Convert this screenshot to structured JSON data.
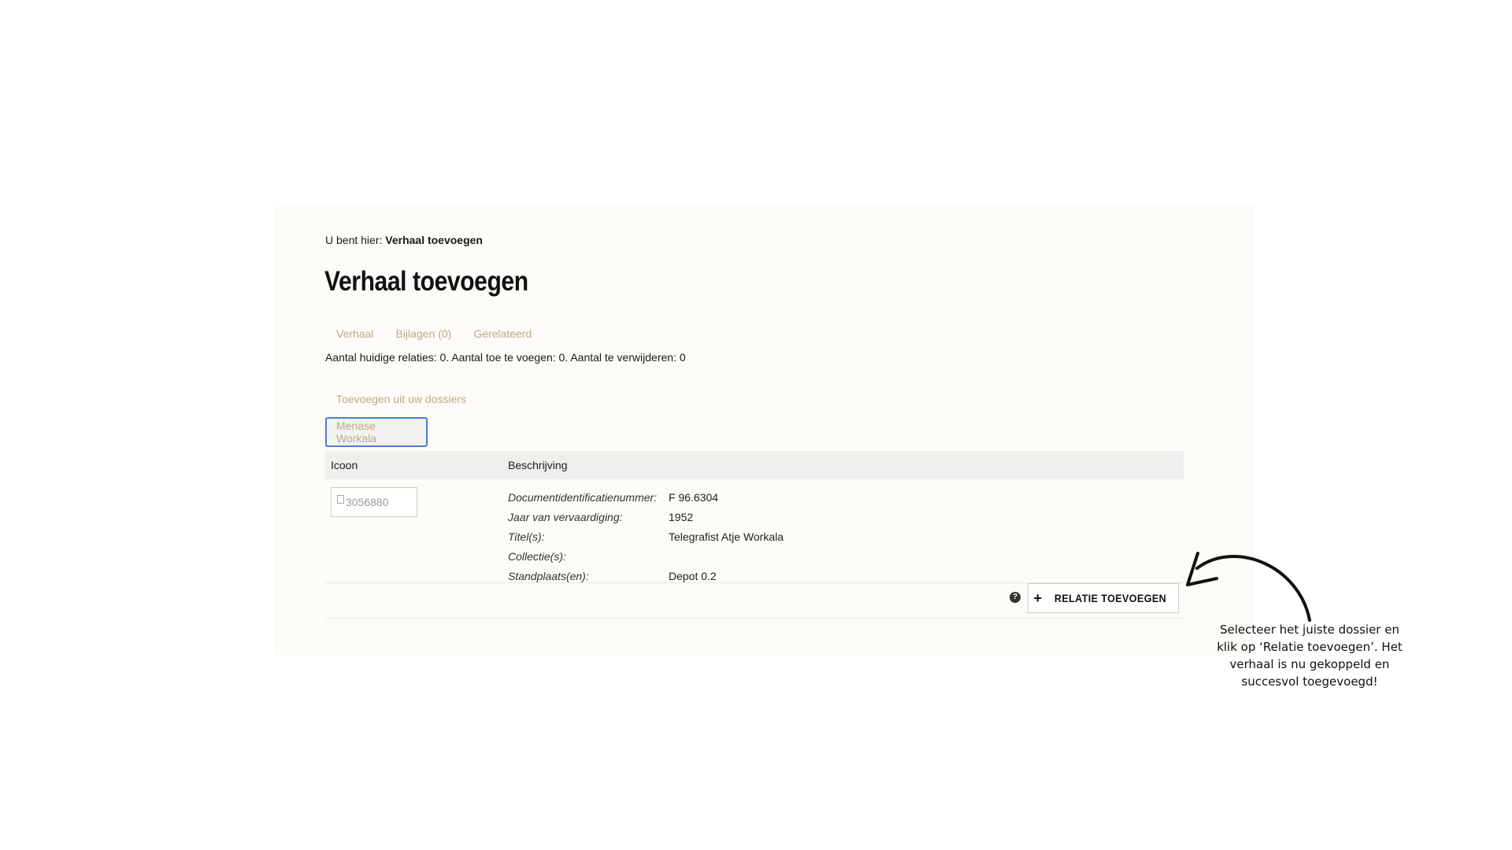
{
  "breadcrumb": {
    "prefix": "U bent hier:",
    "current": "Verhaal toevoegen"
  },
  "page_title": "Verhaal toevoegen",
  "tabs": [
    {
      "label": "Verhaal"
    },
    {
      "label": "Bijlagen (0)"
    },
    {
      "label": "Gerelateerd"
    }
  ],
  "summary": "Aantal huidige relaties: 0. Aantal toe te voegen: 0. Aantal te verwijderen: 0",
  "subtab": {
    "label": "Toevoegen uit uw dossiers"
  },
  "dossier_button": {
    "label": "Menase Workala"
  },
  "table": {
    "headers": {
      "icon": "Icoon",
      "description": "Beschrijving"
    },
    "rows": [
      {
        "thumbnail_alt": "3056880",
        "fields": [
          {
            "label": "Documentidentificatienummer:",
            "value": "F 96.6304"
          },
          {
            "label": "Jaar van vervaardiging:",
            "value": "1952"
          },
          {
            "label": "Titel(s):",
            "value": "Telegrafist Atje Workala"
          },
          {
            "label": "Collectie(s):",
            "value": ""
          },
          {
            "label": "Standplaats(en):",
            "value": "Depot 0.2"
          }
        ]
      }
    ]
  },
  "actions": {
    "help_glyph": "?",
    "add_relation_label": "RELATIE TOEVOEGEN",
    "plus_glyph": "+"
  },
  "annotation": {
    "text": "Selecteer het juiste dossier en klik op ‘Relatie toevoegen’. Het verhaal is nu gekoppeld en succesvol toegevoegd!"
  },
  "colors": {
    "panel_bg": "#fcfbf8",
    "tab_text": "#b9aa8c",
    "focus_border": "#4a7fd4",
    "header_bg": "#f0efee"
  }
}
